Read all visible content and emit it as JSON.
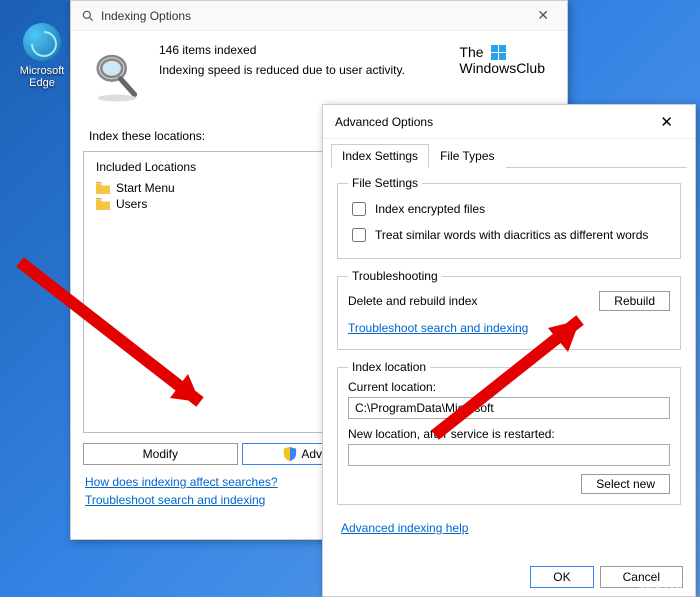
{
  "desktop": {
    "edge_label": "Microsoft\nEdge"
  },
  "indexWin": {
    "title": "Indexing Options",
    "countLine": "146 items indexed",
    "speedLine": "Indexing speed is reduced due to user activity.",
    "brand_line1": "The",
    "brand_line2": "WindowsClub",
    "sectionLabel": "Index these locations:",
    "includedHeader": "Included Locations",
    "locations": [
      "Start Menu",
      "Users"
    ],
    "modifyBtn": "Modify",
    "advancedBtn": "Advanced",
    "link1": "How does indexing affect searches?",
    "link2": "Troubleshoot search and indexing"
  },
  "advWin": {
    "title": "Advanced Options",
    "tabs": [
      "Index Settings",
      "File Types"
    ],
    "fileSettings": {
      "legend": "File Settings",
      "opt1": "Index encrypted files",
      "opt2": "Treat similar words with diacritics as different words"
    },
    "troubleshooting": {
      "legend": "Troubleshooting",
      "deleteLabel": "Delete and rebuild index",
      "rebuildBtn": "Rebuild",
      "link": "Troubleshoot search and indexing"
    },
    "indexLocation": {
      "legend": "Index location",
      "currentLabel": "Current location:",
      "currentValue": "C:\\ProgramData\\Microsoft",
      "newLabel": "New location, after service is restarted:",
      "selectBtn": "Select new"
    },
    "advLink": "Advanced indexing help",
    "okBtn": "OK",
    "cancelBtn": "Cancel"
  },
  "watermark": "wsxdn.com"
}
